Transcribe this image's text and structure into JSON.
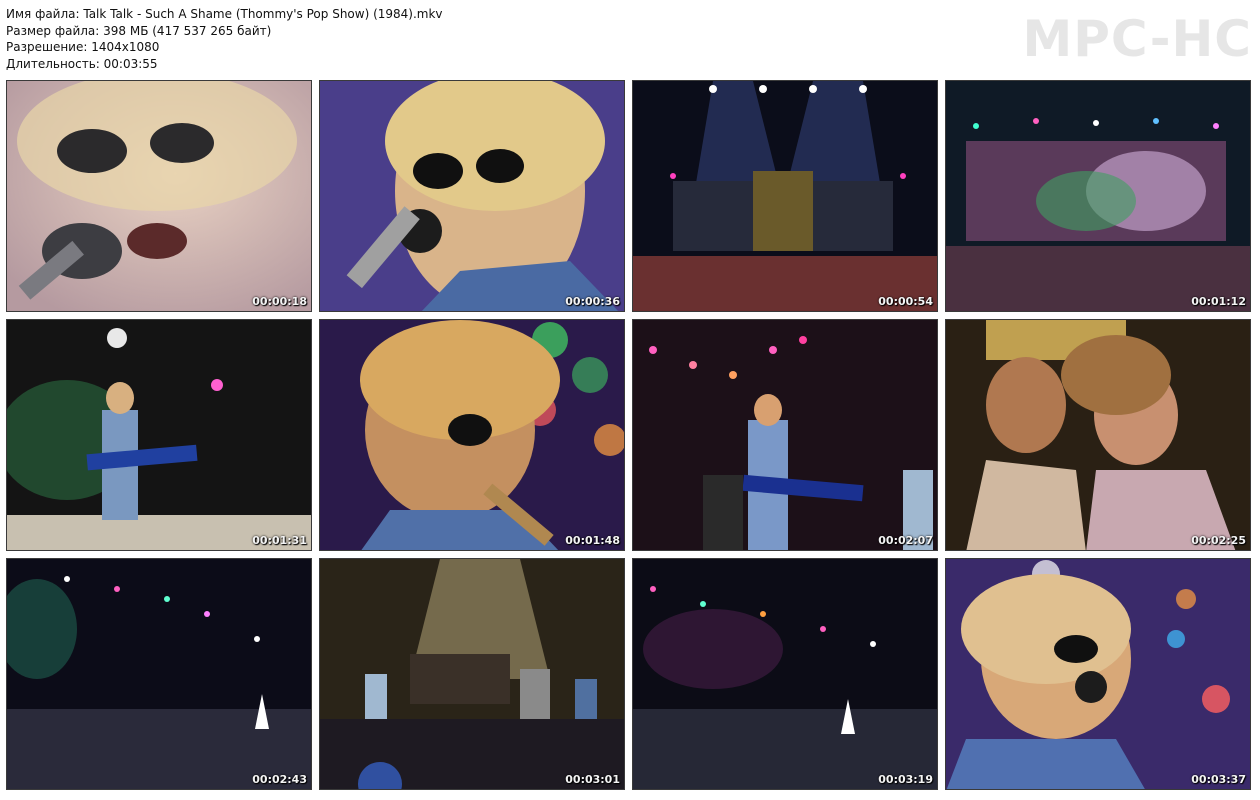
{
  "file_info": {
    "name": "Имя файла: Talk Talk - Such A Shame (Thommy's Pop Show) (1984).mkv",
    "size": "Размер файла: 398 МБ (417 537 265 байт)",
    "resolution": "Разрешение: 1404x1080",
    "duration": "Длительность: 00:03:55"
  },
  "logo": "MPC-HC",
  "thumbnails": [
    {
      "time": "00:00:18",
      "scene": "closeup-soft"
    },
    {
      "time": "00:00:36",
      "scene": "closeup-blue"
    },
    {
      "time": "00:00:54",
      "scene": "stage-wide"
    },
    {
      "time": "00:01:12",
      "scene": "stage-crowd"
    },
    {
      "time": "00:01:31",
      "scene": "guitarist-stage"
    },
    {
      "time": "00:01:48",
      "scene": "closeup-bokeh"
    },
    {
      "time": "00:02:07",
      "scene": "guitarist-dark"
    },
    {
      "time": "00:02:25",
      "scene": "audience-faces"
    },
    {
      "time": "00:02:43",
      "scene": "arena-lights"
    },
    {
      "time": "00:03:01",
      "scene": "band-stage"
    },
    {
      "time": "00:03:19",
      "scene": "arena-lights-2"
    },
    {
      "time": "00:03:37",
      "scene": "closeup-smile"
    }
  ]
}
